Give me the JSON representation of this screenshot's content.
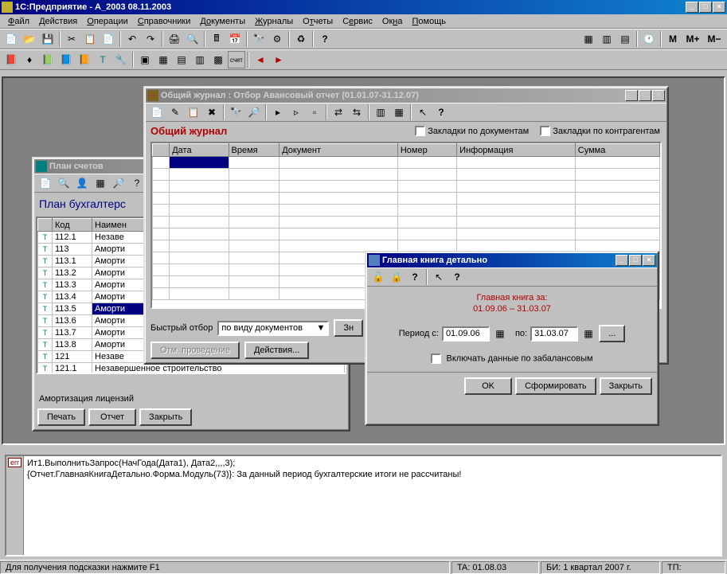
{
  "app": {
    "title": "1С:Предприятие - А_2003  08.11.2003"
  },
  "menu": {
    "items": [
      "Файл",
      "Действия",
      "Операции",
      "Справочники",
      "Документы",
      "Журналы",
      "Отчеты",
      "Сервис",
      "Окна",
      "Помощь"
    ]
  },
  "wbtn": {
    "min": "_",
    "max": "□",
    "close": "×",
    "restore": "❐"
  },
  "plan": {
    "title": "План счетов",
    "heading": "План бухгалтерс",
    "cols": [
      "",
      "Код",
      "Наимен"
    ],
    "rows": [
      {
        "code": "112.1",
        "name": "Незаве"
      },
      {
        "code": "113",
        "name": "Аморти"
      },
      {
        "code": "113.1",
        "name": "Аморти"
      },
      {
        "code": "113.2",
        "name": "Аморти"
      },
      {
        "code": "113.3",
        "name": "Аморти"
      },
      {
        "code": "113.4",
        "name": "Аморти"
      },
      {
        "code": "113.5",
        "name": "Аморти",
        "sel": true
      },
      {
        "code": "113.6",
        "name": "Аморти"
      },
      {
        "code": "113.7",
        "name": "Аморти"
      },
      {
        "code": "113.8",
        "name": "Аморти"
      },
      {
        "code": "121",
        "name": "Незаве"
      },
      {
        "code": "121.1",
        "name": "Незавершенное строительство"
      }
    ],
    "footer": "Амортизация лицензий",
    "btns": {
      "print": "Печать",
      "report": "Отчет",
      "close": "Закрыть"
    }
  },
  "journal": {
    "title": "Общий журнал : Отбор Авансовый отчет (01.01.07-31.12.07)",
    "heading": "Общий журнал",
    "chk1": "Закладки по документам",
    "chk2": "Закладки по контрагентам",
    "cols": [
      "",
      "Дата",
      "Время",
      "Документ",
      "Номер",
      "Информация",
      "Сумма"
    ],
    "filter_label": "Быстрый отбор",
    "filter_value": "по виду документов",
    "filter_btn": "Зн",
    "btn_cancel": "Отм. проведение",
    "btn_actions": "Действия..."
  },
  "book": {
    "title": "Главная книга детально",
    "heading": "Главная книга за:",
    "period_text": "01.09.06 – 31.03.07",
    "from_label": "Период с:",
    "from": "01.09.06",
    "to_label": "по:",
    "to": "31.03.07",
    "dots": "...",
    "chk": "Включать данные по забалансовым",
    "ok": "OK",
    "form": "Сформировать",
    "close": "Закрыть"
  },
  "msg": {
    "line1": "Ит1.ВыполнитьЗапрос(НачГода(Дата1), Дата2,,,,3);",
    "line2": "{Отчет.ГлавнаяКнигаДетально.Форма.Модуль(73)}: За данный период бухгалтерские итоги не рассчитаны!"
  },
  "status": {
    "help": "Для получения подсказки нажмите F1",
    "ta": "TA: 01.08.03",
    "bi": "БИ: 1 квартал 2007 г.",
    "tp": "ТП:"
  }
}
